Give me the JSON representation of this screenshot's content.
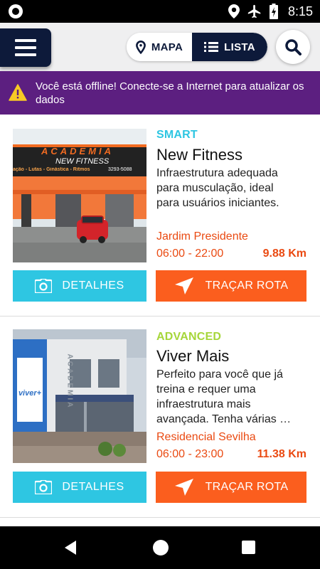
{
  "status_bar": {
    "time": "8:15",
    "icons": [
      "location-icon",
      "airplane-icon",
      "battery-charging-icon"
    ]
  },
  "header": {
    "menu_icon": "hamburger-icon",
    "view_toggle": {
      "map_label": "MAPA",
      "list_label": "LISTA",
      "active": "list"
    },
    "search_icon": "search-icon"
  },
  "offline_banner": {
    "icon": "warning-icon",
    "message": "Você está offline! Conecte-se a Internet para atualizar os dados"
  },
  "gyms": [
    {
      "level": "SMART",
      "level_color": "#2ec6e2",
      "name": "New Fitness",
      "description": "Infraestrutura adequada para musculação, ideal para usuários iniciantes.",
      "neighborhood": "Jardim Presidente",
      "hours": "06:00 - 22:00",
      "distance": "9.88 Km",
      "photo_sign_text": "ACADEMIA",
      "photo_sign_subtext": "NEW FITNESS",
      "photo_sign_small": "ação - Lutas - Ginástica - Ritmos",
      "photo_sign_phone": "3293-5088",
      "details_label": "DETALHES",
      "route_label": "TRAÇAR ROTA"
    },
    {
      "level": "ADVANCED",
      "level_color": "#a6d63a",
      "name": "Viver Mais",
      "description": "Perfeito para você que já treina e requer uma infraestrutura mais avançada. Tenha várias …",
      "neighborhood": "Residencial Sevilha",
      "hours": "06:00 - 23:00",
      "distance": "11.38 Km",
      "photo_logo_text": "viver+",
      "photo_sign_text": "ACADEMIA",
      "details_label": "DETALHES",
      "route_label": "TRAÇAR ROTA"
    }
  ],
  "colors": {
    "navy": "#0d1a3a",
    "purple_banner": "#5c1f80",
    "details_button": "#2ec6e2",
    "route_button": "#fb5e1e",
    "accent_orange": "#ea4a12"
  },
  "nav_bar": {
    "icons": [
      "back-icon",
      "home-icon",
      "recents-icon"
    ]
  }
}
